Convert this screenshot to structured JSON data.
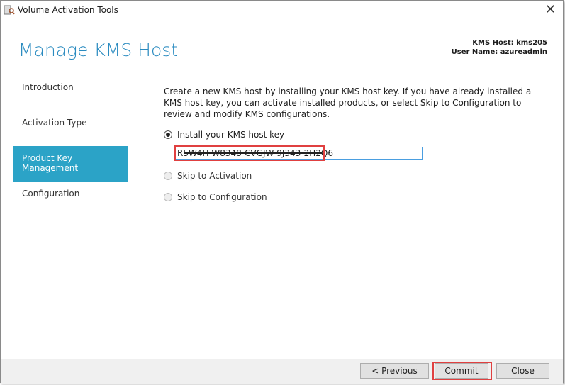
{
  "window": {
    "title": "Volume Activation Tools",
    "close_icon": "close-icon"
  },
  "page": {
    "heading": "Manage KMS Host",
    "kms_host": "KMS Host: kms205",
    "user_name": "User Name: azureadmin"
  },
  "nav": {
    "items": [
      {
        "label": "Introduction"
      },
      {
        "label": "Activation Type"
      },
      {
        "label": "Product Key Management",
        "active": true
      },
      {
        "label": "Configuration"
      }
    ]
  },
  "main": {
    "description": "Create a new KMS host by installing your KMS host key. If you have already installed a KMS host key, you can activate installed products, or select Skip to Configuration to review and modify KMS configurations.",
    "options": [
      {
        "label": "Install your KMS host key",
        "selected": true
      },
      {
        "label": "Skip to Activation",
        "selected": false
      },
      {
        "label": "Skip to Configuration",
        "selected": false
      }
    ],
    "key_value": "R5W4H-W8348-CVGJW-9J343-2H2Q6"
  },
  "footer": {
    "previous": "< Previous",
    "commit": "Commit",
    "close": "Close"
  },
  "colors": {
    "accent": "#2ba3c7",
    "heading": "#2a8bc0",
    "highlight": "#e04040"
  }
}
